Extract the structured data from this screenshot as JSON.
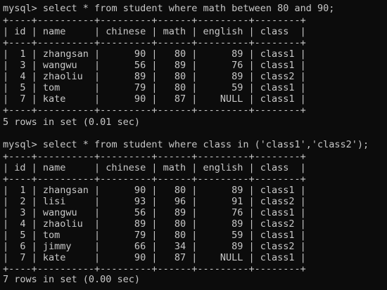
{
  "terminal": {
    "query1": {
      "prompt": "mysql> ",
      "command": "select * from student where math between 80 and 90;",
      "border": "+----+----------+---------+------+---------+--------+",
      "header": [
        "id",
        "name",
        "chinese",
        "math",
        "english",
        "class"
      ],
      "rows": [
        [
          "1",
          "zhangsan",
          "90",
          "80",
          "89",
          "class1"
        ],
        [
          "3",
          "wangwu",
          "56",
          "89",
          "76",
          "class1"
        ],
        [
          "4",
          "zhaoliu",
          "89",
          "80",
          "89",
          "class2"
        ],
        [
          "5",
          "tom",
          "79",
          "80",
          "59",
          "class1"
        ],
        [
          "7",
          "kate",
          "90",
          "87",
          "NULL",
          "class1"
        ]
      ],
      "summary": "5 rows in set (0.01 sec)"
    },
    "query2": {
      "prompt": "mysql> ",
      "command": "select * from student where class in ('class1','class2');",
      "border": "+----+----------+---------+------+---------+--------+",
      "header": [
        "id",
        "name",
        "chinese",
        "math",
        "english",
        "class"
      ],
      "rows": [
        [
          "1",
          "zhangsan",
          "90",
          "80",
          "89",
          "class1"
        ],
        [
          "2",
          "lisi",
          "93",
          "96",
          "91",
          "class2"
        ],
        [
          "3",
          "wangwu",
          "56",
          "89",
          "76",
          "class1"
        ],
        [
          "4",
          "zhaoliu",
          "89",
          "80",
          "89",
          "class2"
        ],
        [
          "5",
          "tom",
          "79",
          "80",
          "59",
          "class1"
        ],
        [
          "6",
          "jimmy",
          "66",
          "34",
          "89",
          "class2"
        ],
        [
          "7",
          "kate",
          "90",
          "87",
          "NULL",
          "class1"
        ]
      ],
      "summary": "7 rows in set (0.00 sec)"
    }
  }
}
